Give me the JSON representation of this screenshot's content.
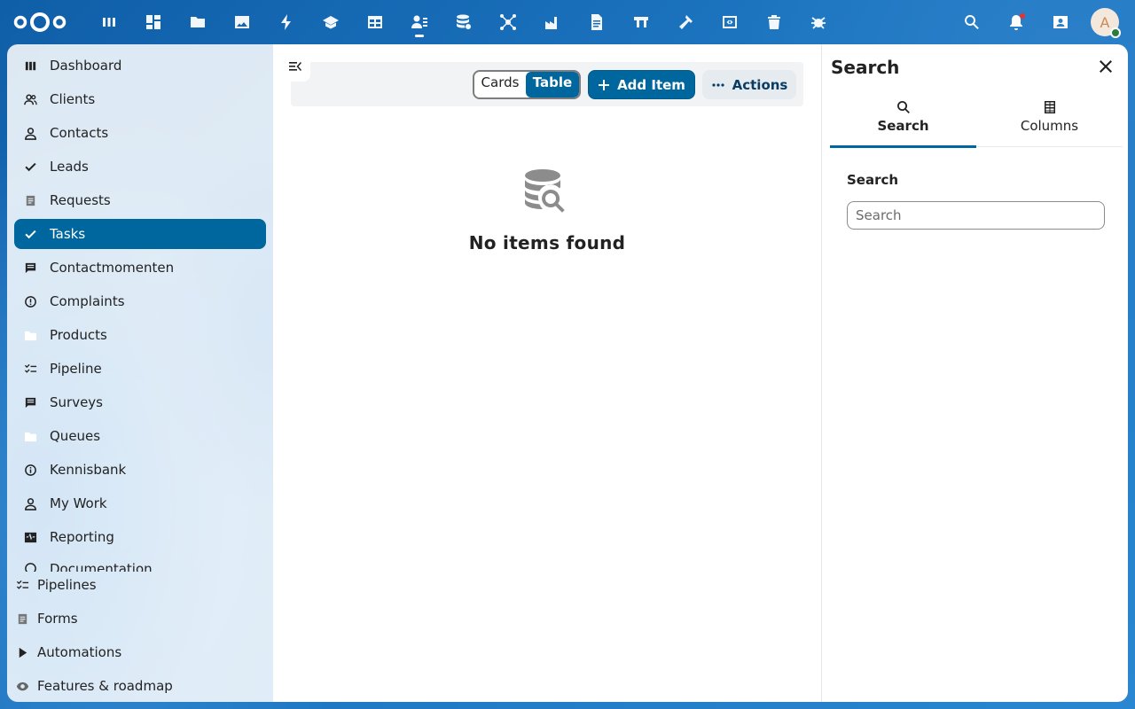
{
  "header": {
    "apps": [
      {
        "icon": "apps-grid-icon"
      },
      {
        "icon": "dashboard-icon"
      },
      {
        "icon": "files-icon"
      },
      {
        "icon": "photos-icon"
      },
      {
        "icon": "activity-icon"
      },
      {
        "icon": "learn-icon"
      },
      {
        "icon": "calendar-table-icon"
      },
      {
        "icon": "contacts-crm-icon"
      },
      {
        "icon": "database-icon"
      },
      {
        "icon": "network-icon"
      },
      {
        "icon": "factory-icon"
      },
      {
        "icon": "document-icon"
      },
      {
        "icon": "flag-icon"
      },
      {
        "icon": "hammer-icon"
      },
      {
        "icon": "code-icon"
      },
      {
        "icon": "trash-icon"
      },
      {
        "icon": "bug-icon"
      }
    ],
    "avatar_initial": "A"
  },
  "sidebar": {
    "items": [
      {
        "label": "Dashboard",
        "icon": "dashboard-icon"
      },
      {
        "label": "Clients",
        "icon": "users-icon"
      },
      {
        "label": "Contacts",
        "icon": "user-icon"
      },
      {
        "label": "Leads",
        "icon": "check-icon"
      },
      {
        "label": "Requests",
        "icon": "document-icon"
      },
      {
        "label": "Tasks",
        "icon": "check-icon"
      },
      {
        "label": "Contactmomenten",
        "icon": "message-icon"
      },
      {
        "label": "Complaints",
        "icon": "alert-circle-icon"
      },
      {
        "label": "Products",
        "icon": "folder-icon"
      },
      {
        "label": "Pipeline",
        "icon": "checklist-icon"
      },
      {
        "label": "Surveys",
        "icon": "message-icon"
      },
      {
        "label": "Queues",
        "icon": "folder-icon"
      },
      {
        "label": "Kennisbank",
        "icon": "info-icon"
      },
      {
        "label": "My Work",
        "icon": "user-icon"
      },
      {
        "label": "Reporting",
        "icon": "pulse-icon"
      },
      {
        "label": "Documentation",
        "icon": "info-icon"
      }
    ],
    "active_index": 5,
    "bottom_items": [
      {
        "label": "Pipelines",
        "icon": "checklist-icon"
      },
      {
        "label": "Forms",
        "icon": "document-icon"
      },
      {
        "label": "Automations",
        "icon": "play-icon"
      },
      {
        "label": "Features & roadmap",
        "icon": "eye-icon"
      }
    ]
  },
  "main": {
    "view_switch": {
      "cards": "Cards",
      "table": "Table",
      "selected": "Table"
    },
    "add_item_label": "Add Item",
    "actions_label": "Actions",
    "empty_message": "No items found"
  },
  "panel": {
    "title": "Search",
    "tabs": [
      {
        "label": "Search",
        "icon": "magnify-icon"
      },
      {
        "label": "Columns",
        "icon": "columns-icon"
      }
    ],
    "active_tab": "Search",
    "field_label": "Search",
    "search_placeholder": "Search",
    "search_value": ""
  },
  "colors": {
    "primary": "#00679e",
    "header_bg": "#1a6fb8"
  }
}
